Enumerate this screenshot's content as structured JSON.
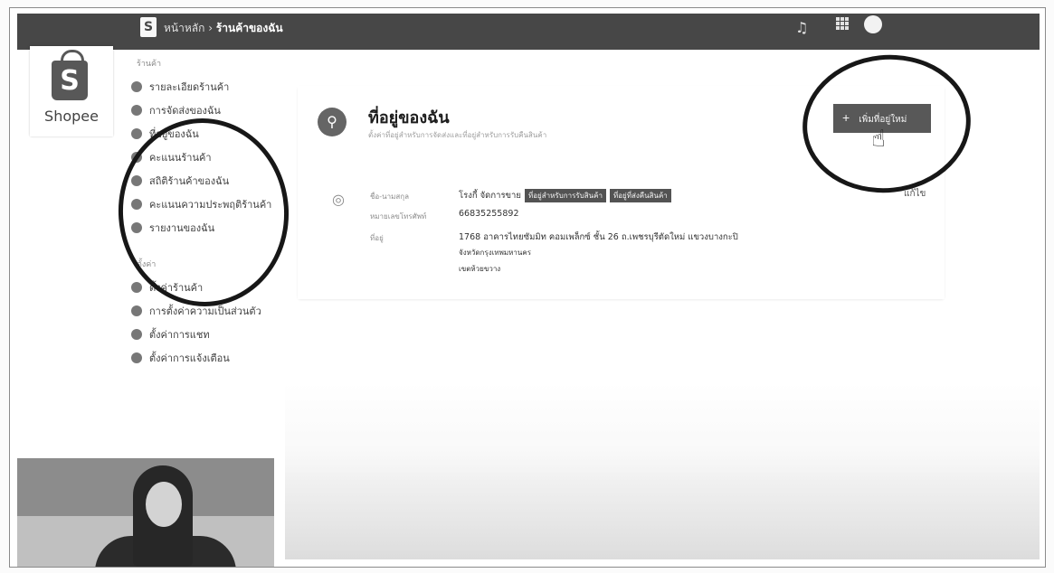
{
  "topbar": {
    "bag_letter": "S",
    "breadcrumb_parent": "หน้าหลัก",
    "breadcrumb_separator": " › ",
    "breadcrumb_current": "ร้านค้าของฉัน",
    "user_name": "",
    "bell_icon": "bell-icon",
    "apps_icon": "grid-icon"
  },
  "logo": {
    "letter": "S",
    "name": "Shopee"
  },
  "sidebar": {
    "section_shop": "ร้านค้า",
    "shop_items": [
      {
        "label": "รายละเอียดร้านค้า"
      },
      {
        "label": "การจัดส่งของฉัน"
      },
      {
        "label": "ที่อยู่ของฉัน"
      },
      {
        "label": "คะแนนร้านค้า"
      },
      {
        "label": "สถิติร้านค้าของฉัน"
      },
      {
        "label": "คะแนนความประพฤติร้านค้า"
      },
      {
        "label": "รายงานของฉัน"
      }
    ],
    "section_settings": "ตั้งค่า",
    "settings_items": [
      {
        "label": "ตั้งค่าร้านค้า"
      },
      {
        "label": "การตั้งค่าความเป็นส่วนตัว"
      },
      {
        "label": "ตั้งค่าการแชท"
      },
      {
        "label": "ตั้งค่าการแจ้งเตือน"
      }
    ]
  },
  "address_card": {
    "title": "ที่อยู่ของฉัน",
    "subtitle": "ตั้งค่าที่อยู่สำหรับการจัดส่งและที่อยู่สำหรับการรับคืนสินค้า",
    "add_button_label": "เพิ่มที่อยู่ใหม่",
    "add_button_icon": "plus-icon",
    "entry": {
      "name_label": "ชื่อ-นามสกุล",
      "name_value": "โรงกี้ จัดการขาย",
      "badge_1": "ที่อยู่สำหรับการรับสินค้า",
      "badge_2": "ที่อยู่ที่ส่งคืนสินค้า",
      "phone_label": "หมายเลขโทรศัพท์",
      "phone_value": "66835255892",
      "address_label": "ที่อยู่",
      "address_line_1": "1768 อาคารไทยซัมมิท คอมเพล็กซ์ ชั้น 26 ถ.เพชรบุรีตัดใหม่ แขวงบางกะปิ",
      "address_line_2": "จังหวัดกรุงเทพมหานคร",
      "address_line_3": "เขตห้วยขวาง",
      "edit_label": "แก้ไข"
    }
  },
  "colors": {
    "topbar_bg": "#4a4a4a",
    "annotation_circle": "#1c1c1c"
  }
}
